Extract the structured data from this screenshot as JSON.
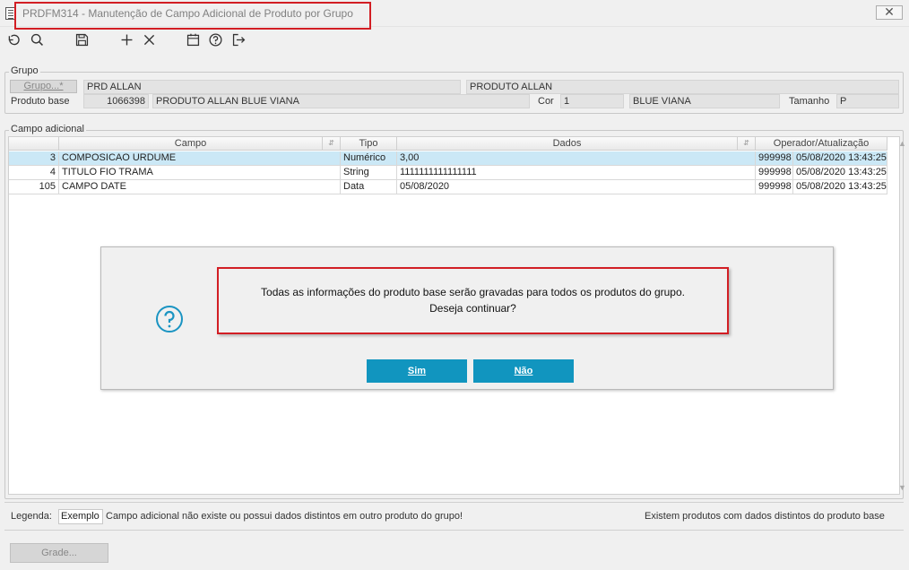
{
  "window": {
    "title": "PRDFM314 - Manutenção de Campo Adicional de Produto por Grupo",
    "close_glyph": "✕",
    "icons": [
      "undo-icon",
      "search-icon",
      "save-icon",
      "add-icon",
      "delete-icon",
      "calendar-icon",
      "help-icon",
      "exit-icon"
    ]
  },
  "grupo": {
    "title": "Grupo",
    "grupo_button": "Grupo...*",
    "grupo_code": "PRD ALLAN",
    "grupo_desc": "PRODUTO ALLAN",
    "produto_base_label": "Produto base",
    "produto_code": "1066398",
    "produto_desc": "PRODUTO ALLAN BLUE VIANA",
    "cor_label": "Cor",
    "cor_code": "1",
    "cor_desc": "BLUE VIANA",
    "tamanho_label": "Tamanho",
    "tamanho_value": "P"
  },
  "campo_adicional": {
    "title": "Campo adicional",
    "headers": {
      "campo": "Campo",
      "tipo": "Tipo",
      "dados": "Dados",
      "operador": "Operador/Atualização"
    },
    "rows": [
      {
        "num": "3",
        "campo": "COMPOSICAO URDUME",
        "tipo": "Numérico",
        "dados": "3,00",
        "operador": "999998",
        "data": "05/08/2020 13:43:25"
      },
      {
        "num": "4",
        "campo": "TITULO FIO TRAMA",
        "tipo": "String",
        "dados": "1111111111111111",
        "operador": "999998",
        "data": "05/08/2020 13:43:25"
      },
      {
        "num": "105",
        "campo": "CAMPO DATE",
        "tipo": "Data",
        "dados": "05/08/2020",
        "operador": "999998",
        "data": "05/08/2020 13:43:25"
      }
    ]
  },
  "dialog": {
    "message_line1": "Todas as informações do produto base serão gravadas para todos os produtos do grupo.",
    "message_line2": "Deseja continuar?",
    "yes_label": "Sim",
    "no_label": "Não",
    "accent": "#1195bf"
  },
  "legend": {
    "label": "Legenda:",
    "example": "Exemplo",
    "text_left": "Campo adicional não existe ou possui dados distintos em outro produto do grupo!",
    "text_right": "Existem produtos com dados distintos do produto base"
  },
  "footer": {
    "grade_button": "Grade..."
  }
}
